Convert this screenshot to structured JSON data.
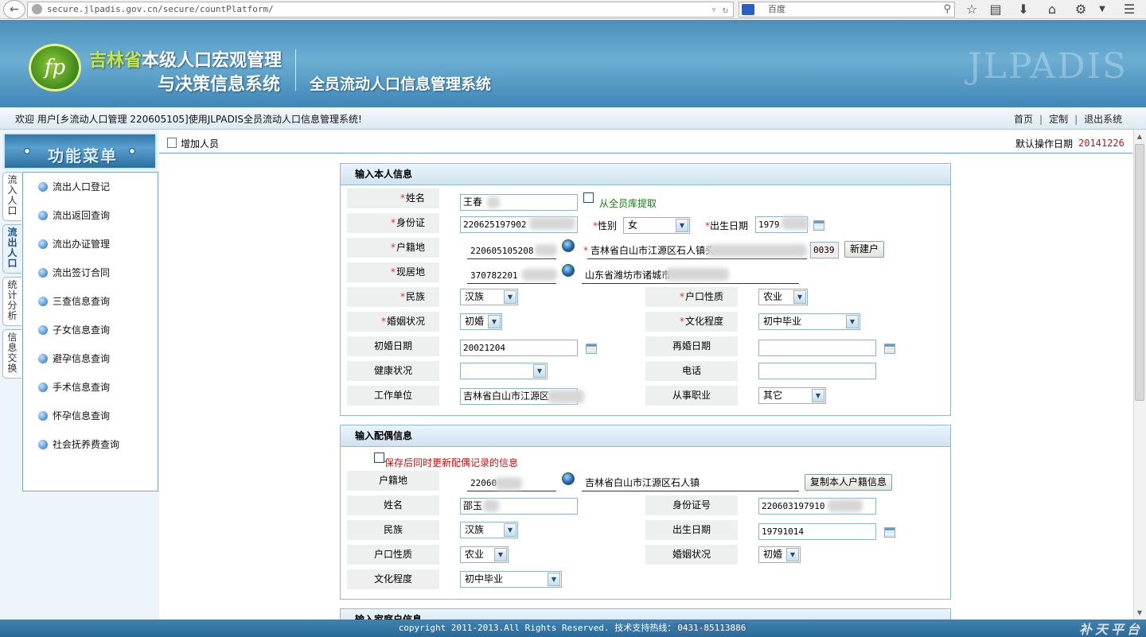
{
  "browser": {
    "url": "secure.jlpadis.gov.cn/secure/countPlatform/",
    "search_engine_text": "百度"
  },
  "header": {
    "province": "吉林省",
    "title_part1": "本级人口宏观管理",
    "title_part2": "与决策信息系统",
    "system_name": "全员流动人口信息管理系统",
    "watermark": "JLPADIS",
    "logo_letter": "fp"
  },
  "welcome": {
    "text": "欢迎 用户[乡流动人口管理 220605105]使用JLPADIS全员流动人口信息管理系统!",
    "links": [
      "首页",
      "定制",
      "退出系统"
    ]
  },
  "sidebar": {
    "menu_title": "功能菜单",
    "tabs": [
      "流入人口",
      "流出人口",
      "统计分析",
      "信息交换"
    ],
    "items": [
      "流出人口登记",
      "流出返回查询",
      "流出办证管理",
      "流出签订合同",
      "三查信息查询",
      "子女信息查询",
      "避孕信息查询",
      "手术信息查询",
      "怀孕信息查询",
      "社会抚养费查询"
    ]
  },
  "main": {
    "page_title": "增加人员",
    "date_label": "默认操作日期",
    "date_value": "20141226"
  },
  "self_panel": {
    "heading": "输入本人信息",
    "labels": {
      "name": "姓名",
      "id": "身份证",
      "gender": "性别",
      "birth": "出生日期",
      "huji": "户籍地",
      "residence": "现居地",
      "ethnic": "民族",
      "hukou_type": "户口性质",
      "marital": "婚姻状况",
      "education": "文化程度",
      "first_marriage": "初婚日期",
      "remarriage": "再婚日期",
      "health": "健康状况",
      "phone": "电话",
      "workplace": "工作单位",
      "occupation": "从事职业"
    },
    "name_value": "王春",
    "fetch_label": "从全员库提取",
    "id_value": "220625197902",
    "gender_value": "女",
    "birth_value": "1979",
    "huji_code": "220605105208",
    "huji_address": "吉林省白山市江源区石人镇头",
    "huji_suffix": "0039",
    "new_household_btn": "新建户",
    "residence_code": "370782201",
    "residence_address": "山东省潍坊市诸城市",
    "ethnic_value": "汉族",
    "hukou_value": "农业",
    "marital_value": "初婚",
    "education_value": "初中毕业",
    "first_marriage_value": "20021204",
    "remarriage_value": "",
    "health_value": "",
    "phone_value": "",
    "workplace_value": "吉林省白山市江源区",
    "occupation_value": "其它"
  },
  "spouse_panel": {
    "heading": "输入配偶信息",
    "sync_label": "保存后同时更新配偶记录的信息",
    "labels": {
      "huji": "户籍地",
      "name": "姓名",
      "id": "身份证号",
      "ethnic": "民族",
      "birth": "出生日期",
      "hukou_type": "户口性质",
      "marital": "婚姻状况",
      "education": "文化程度"
    },
    "huji_code": "22060",
    "huji_address": "吉林省白山市江源区石人镇",
    "copy_btn": "复制本人户籍信息",
    "name_value": "邵玉",
    "id_value": "220603197910",
    "ethnic_value": "汉族",
    "birth_value": "19791014",
    "hukou_value": "农业",
    "marital_value": "初婚",
    "education_value": "初中毕业"
  },
  "household_panel": {
    "heading": "输入家庭户信息"
  },
  "footer": {
    "text": "copyright 2011-2013.All Rights Reserved. 技术支持热线：",
    "hotline": "0431-85113886",
    "signature": "补天平台"
  },
  "colors": {
    "banner": "#4a8fba",
    "required": "#e2321d",
    "date_value": "#c41111",
    "footer": "#3a7aaa"
  }
}
